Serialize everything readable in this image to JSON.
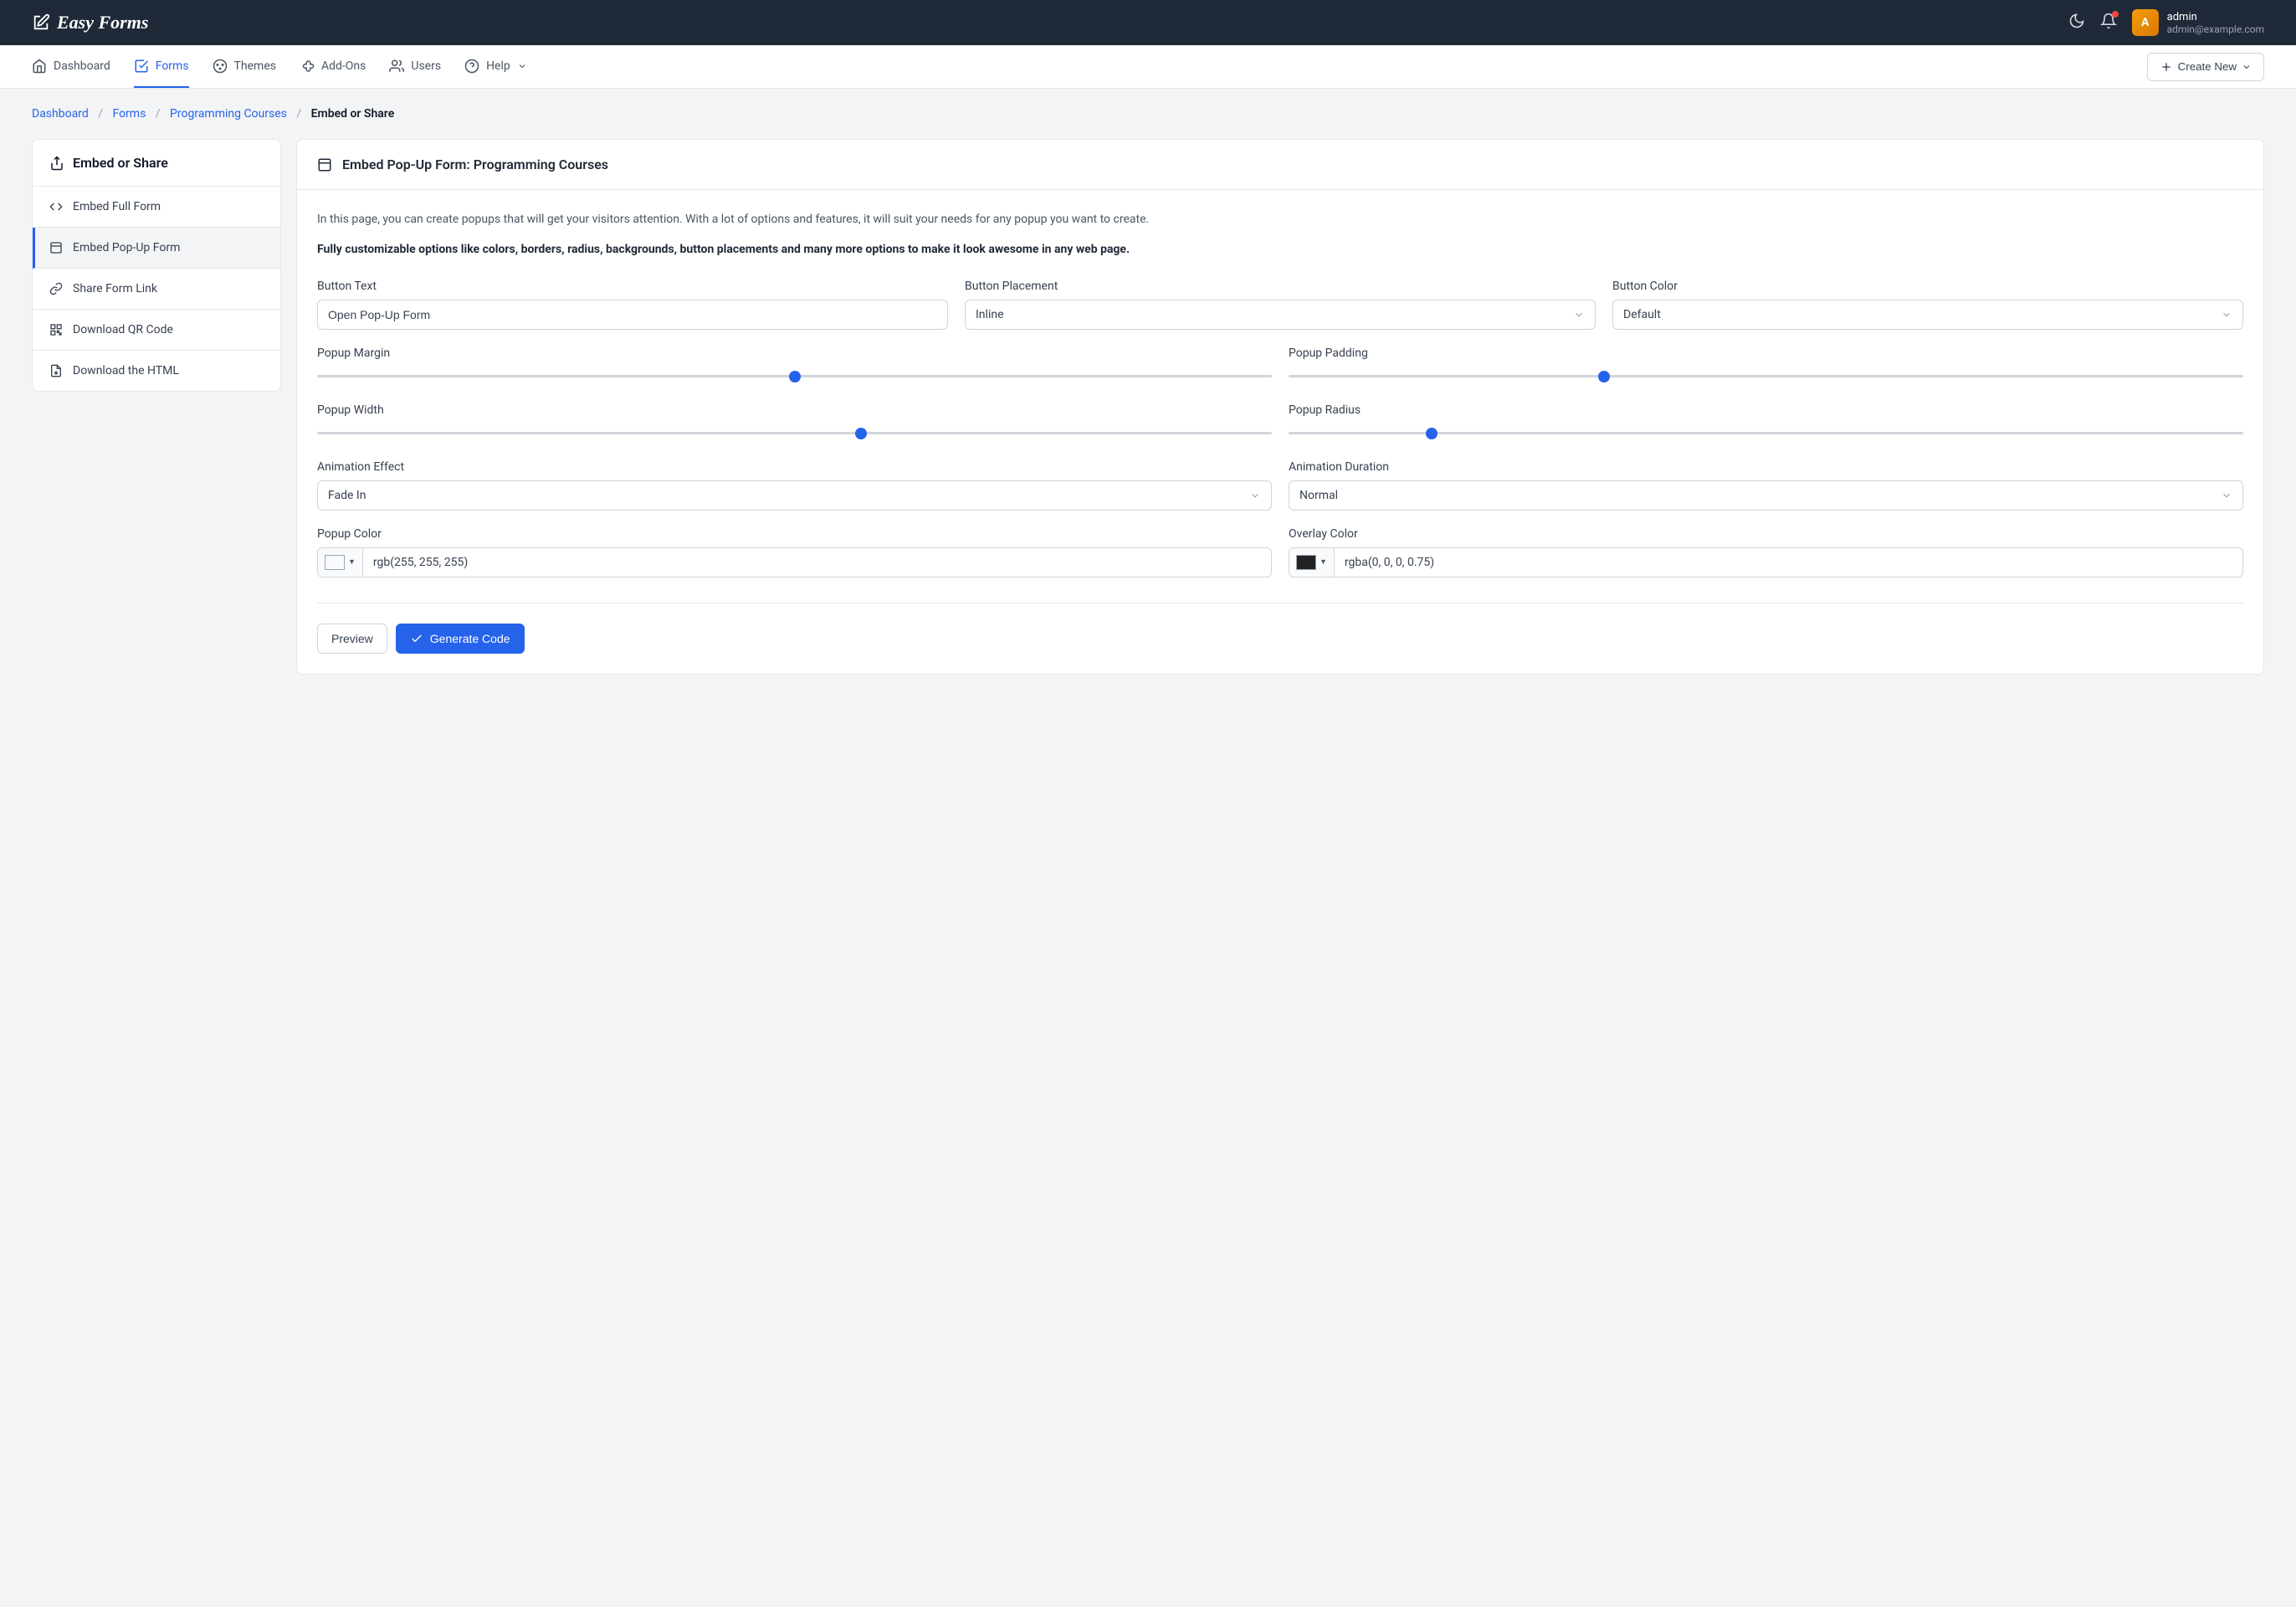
{
  "header": {
    "logo": "Easy Forms",
    "user": {
      "name": "admin",
      "email": "admin@example.com"
    }
  },
  "nav": {
    "items": [
      {
        "label": "Dashboard"
      },
      {
        "label": "Forms"
      },
      {
        "label": "Themes"
      },
      {
        "label": "Add-Ons"
      },
      {
        "label": "Users"
      },
      {
        "label": "Help"
      }
    ],
    "create_label": "Create New"
  },
  "breadcrumb": {
    "items": [
      "Dashboard",
      "Forms",
      "Programming Courses"
    ],
    "current": "Embed or Share"
  },
  "sidebar": {
    "title": "Embed or Share",
    "items": [
      {
        "label": "Embed Full Form"
      },
      {
        "label": "Embed Pop-Up Form"
      },
      {
        "label": "Share Form Link"
      },
      {
        "label": "Download QR Code"
      },
      {
        "label": "Download the HTML"
      }
    ]
  },
  "panel": {
    "title": "Embed Pop-Up Form: Programming Courses",
    "desc1": "In this page, you can create popups that will get your visitors attention. With a lot of options and features, it will suit your needs for any popup you want to create.",
    "desc2": "Fully customizable options like colors, borders, radius, backgrounds, button placements and many more options to make it look awesome in any web page.",
    "fields": {
      "button_text": {
        "label": "Button Text",
        "value": "Open Pop-Up Form"
      },
      "button_placement": {
        "label": "Button Placement",
        "value": "Inline"
      },
      "button_color": {
        "label": "Button Color",
        "value": "Default"
      },
      "popup_margin": {
        "label": "Popup Margin",
        "value_pct": 50
      },
      "popup_padding": {
        "label": "Popup Padding",
        "value_pct": 33
      },
      "popup_width": {
        "label": "Popup Width",
        "value_pct": 57
      },
      "popup_radius": {
        "label": "Popup Radius",
        "value_pct": 15
      },
      "animation_effect": {
        "label": "Animation Effect",
        "value": "Fade In"
      },
      "animation_duration": {
        "label": "Animation Duration",
        "value": "Normal"
      },
      "popup_color": {
        "label": "Popup Color",
        "value": "rgb(255, 255, 255)",
        "swatch": "#ffffff"
      },
      "overlay_color": {
        "label": "Overlay Color",
        "value": "rgba(0, 0, 0, 0.75)",
        "swatch": "#000000"
      }
    },
    "buttons": {
      "preview": "Preview",
      "generate": "Generate Code"
    }
  }
}
